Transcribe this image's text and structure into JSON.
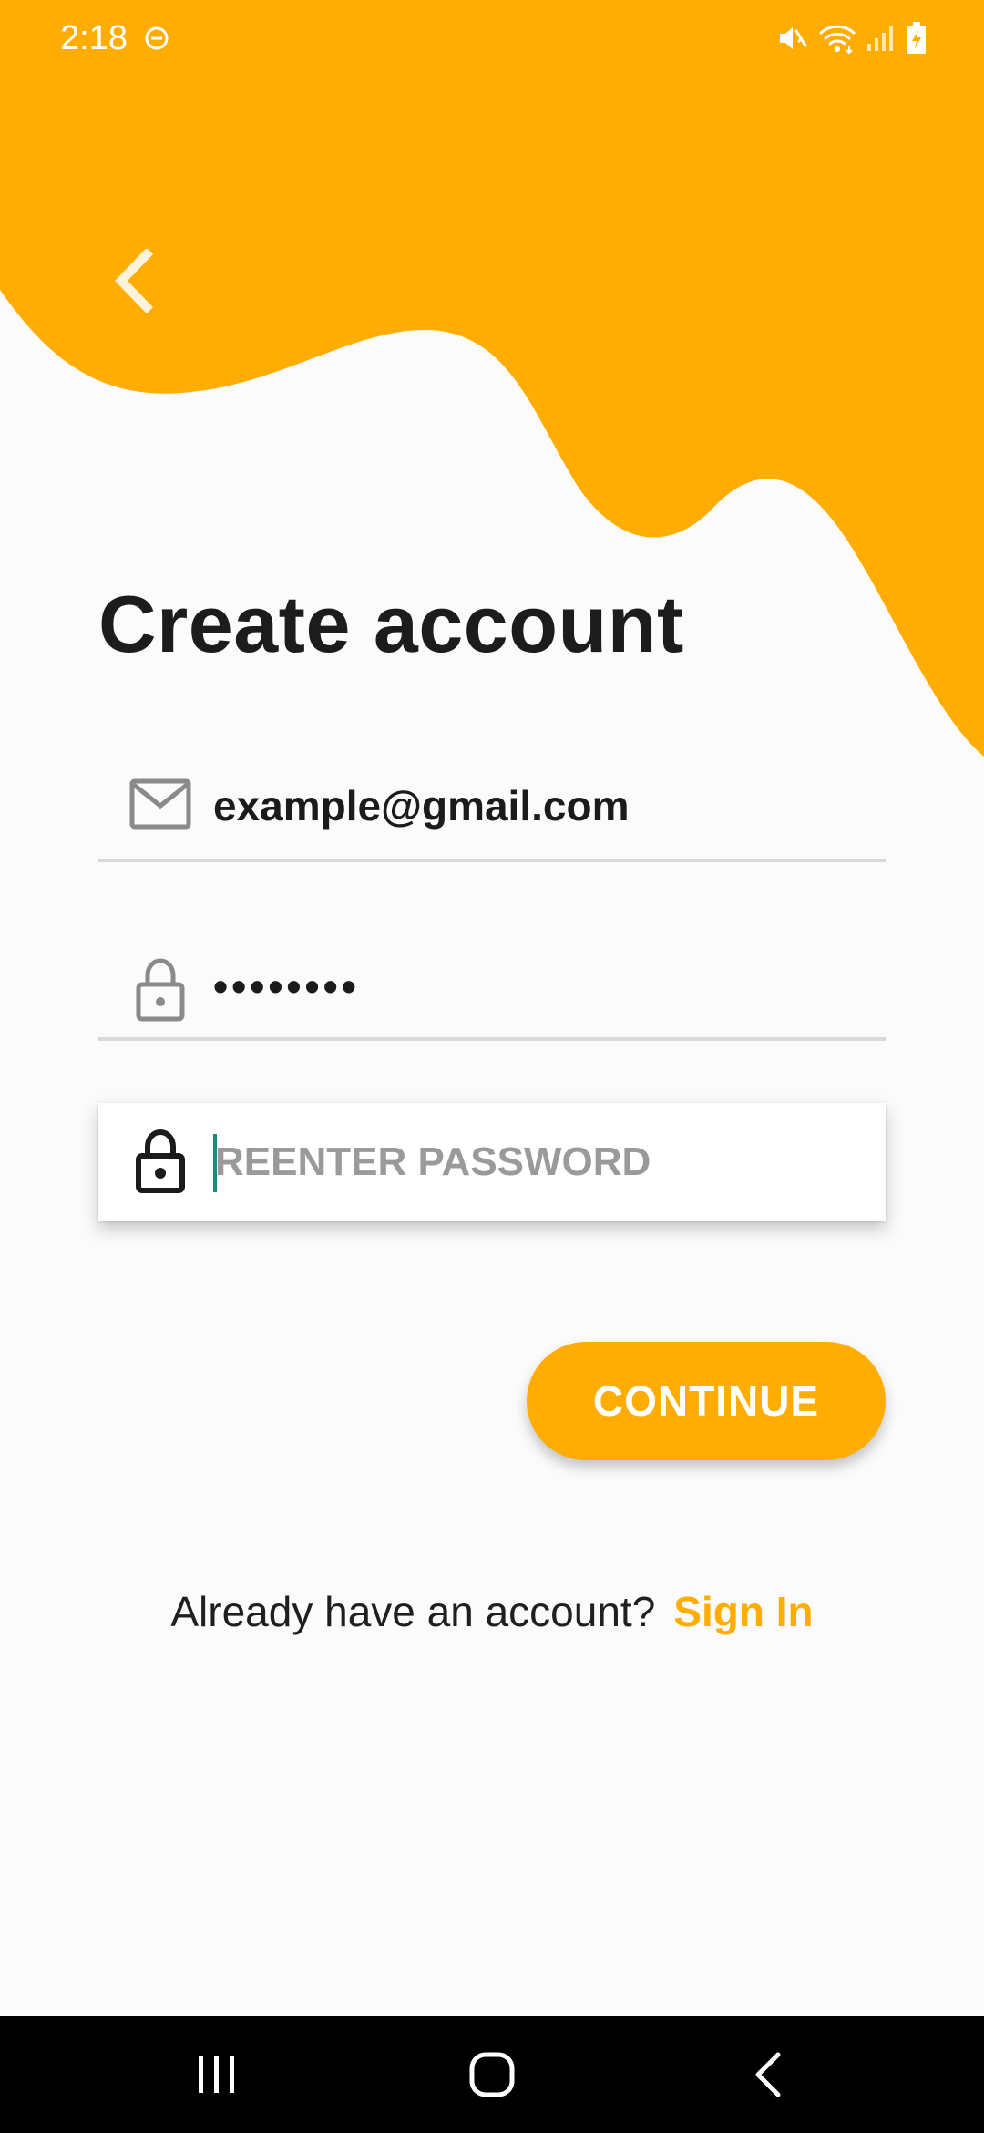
{
  "status_bar": {
    "time": "2:18",
    "icons": [
      "do-not-disturb-icon",
      "mute-icon",
      "wifi-icon",
      "cell-signal-icon",
      "battery-charging-icon"
    ]
  },
  "header": {
    "back_icon": "chevron-left-icon"
  },
  "main": {
    "title": "Create account",
    "email": {
      "icon": "mail-icon",
      "value": "example@gmail.com"
    },
    "password": {
      "icon": "lock-icon",
      "value": "••••••••"
    },
    "reenter_password": {
      "icon": "lock-icon",
      "value": "",
      "placeholder": "REENTER PASSWORD"
    },
    "continue_label": "CONTINUE",
    "signin_prompt": "Already have an account?",
    "signin_link": "Sign In"
  },
  "nav_bar": {
    "items": [
      "recents-icon",
      "home-icon",
      "back-icon"
    ]
  },
  "colors": {
    "accent": "#ffad03",
    "background": "#fbfbfb",
    "text": "#1c1c1c",
    "placeholder": "#9a9a9a",
    "underline": "#d9d9d9",
    "cursor": "#1e8a7a"
  }
}
